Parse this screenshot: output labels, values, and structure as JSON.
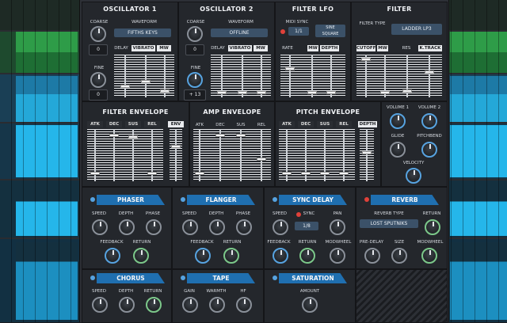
{
  "colors": {
    "accent": "#1f6fb0",
    "knob_blue": "#57a3e0",
    "knob_green": "#7cc88a",
    "led_red": "#e0413a"
  },
  "osc1": {
    "title": "OSCILLATOR 1",
    "coarse_label": "COARSE",
    "coarse_value": "0",
    "waveform_label": "WAVEFORM",
    "waveform_value": "FIFTHS KEYS",
    "fine_label": "FINE",
    "fine_value": "0",
    "delay_label": "DELAY",
    "vibrato_label": "VIBRATO",
    "mw_label": "MW"
  },
  "osc2": {
    "title": "OSCILLATOR 2",
    "coarse_label": "COARSE",
    "coarse_value": "0",
    "waveform_label": "WAVEFORM",
    "waveform_value": "OFFLINE",
    "fine_label": "FINE",
    "fine_value": "+ 13",
    "delay_label": "DELAY",
    "vibrato_label": "VIBRATO",
    "mw_label": "MW"
  },
  "lfo": {
    "title": "FILTER LFO",
    "midi_sync_label": "MIDI SYNC",
    "rate_value": "1/1",
    "wave_value": "SINE\nSQUARE",
    "rate_label": "RATE",
    "mw_label": "MW",
    "depth_label": "DEPTH"
  },
  "filter": {
    "title": "FILTER",
    "type_label": "FILTER TYPE",
    "type_value": "LADDER LP3",
    "cutoff_label": "CUTOFF",
    "mw_label": "MW",
    "res_label": "RES",
    "ktrack_label": "K.TRACK"
  },
  "filter_env": {
    "title": "FILTER ENVELOPE",
    "atk": "ATK",
    "dec": "DEC",
    "sus": "SUS",
    "rel": "REL",
    "env": "ENV"
  },
  "amp_env": {
    "title": "AMP ENVELOPE",
    "atk": "ATK",
    "dec": "DEC",
    "sus": "SUS",
    "rel": "REL"
  },
  "pitch_env": {
    "title": "PITCH ENVELOPE",
    "atk": "ATK",
    "dec": "DEC",
    "sus": "SUS",
    "rel": "REL",
    "depth": "DEPTH"
  },
  "volumes": {
    "vol1": "VOLUME 1",
    "vol2": "VOLUME 2",
    "glide": "GLIDE",
    "pitchbend": "PITCHBEND",
    "velocity": "VELOCITY"
  },
  "phaser": {
    "title": "PHASER",
    "speed": "SPEED",
    "depth": "DEPTH",
    "phase": "PHASE",
    "feedback": "FEEDBACK",
    "return": "RETURN"
  },
  "flanger": {
    "title": "FLANGER",
    "speed": "SPEED",
    "depth": "DEPTH",
    "phase": "PHASE",
    "feedback": "FEEDBACK",
    "return": "RETURN"
  },
  "sync_delay": {
    "title": "SYNC DELAY",
    "speed": "SPEED",
    "sync": "SYNC",
    "pan": "PAN",
    "time_value": "1/8",
    "feedback": "FEEDBACK",
    "return": "RETURN",
    "modwheel": "MODWHEEL"
  },
  "reverb": {
    "title": "REVERB",
    "type_label": "REVERB TYPE",
    "type_value": "LOST SPUTNIKS",
    "return": "RETURN",
    "predelay": "PRE-DELAY",
    "size": "SIZE",
    "modwheel": "MODWHEEL"
  },
  "chorus": {
    "title": "CHORUS",
    "speed": "SPEED",
    "depth": "DEPTH",
    "return": "RETURN"
  },
  "tape": {
    "title": "TAPE",
    "gain": "GAIN",
    "warmth": "WARMTH",
    "hf": "HF"
  },
  "saturation": {
    "title": "SATURATION",
    "amount": "AMOUNT"
  }
}
